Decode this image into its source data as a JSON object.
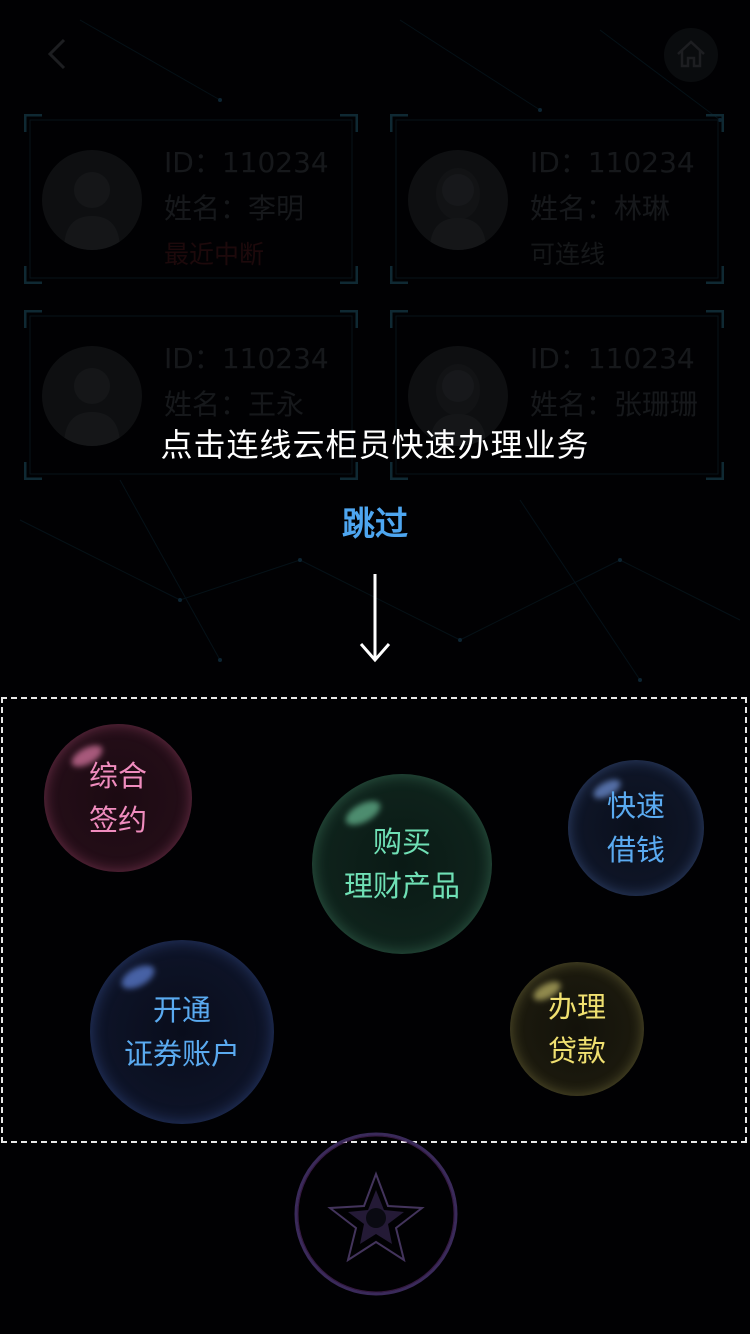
{
  "header": {
    "back_icon": "chevron-left-icon",
    "home_icon": "home-icon"
  },
  "agents": [
    {
      "id_label": "ID：110234",
      "name_label": "姓名：李明",
      "status": "最近中断",
      "status_color": "#3a1217",
      "avatar": "male-avatar-icon"
    },
    {
      "id_label": "ID：110234",
      "name_label": "姓名：林琳",
      "status": "可连线",
      "status_color": "#2b2e33",
      "avatar": "female-avatar-icon"
    },
    {
      "id_label": "ID：110234",
      "name_label": "姓名：王永",
      "status": "",
      "avatar": "male-avatar-icon"
    },
    {
      "id_label": "ID：110234",
      "name_label": "姓名：张珊珊",
      "status": "",
      "avatar": "female-avatar-icon"
    }
  ],
  "guide": {
    "hint": "点击连线云柜员快速办理业务",
    "skip_label": "跳过",
    "arrow_icon": "arrow-down-icon"
  },
  "services": [
    {
      "label": "综合\n签约",
      "color": "#f08cbe"
    },
    {
      "label": "购买\n理财产品",
      "color": "#6fe0b5"
    },
    {
      "label": "快速\n借钱",
      "color": "#5aaaf0"
    },
    {
      "label": "开通\n证券账户",
      "color": "#5aaaf0"
    },
    {
      "label": "办理\n贷款",
      "color": "#f0e070"
    }
  ],
  "footer": {
    "logo_icon": "star-logo-icon"
  },
  "colors": {
    "accent": "#4ea6f0",
    "background": "#020306"
  }
}
